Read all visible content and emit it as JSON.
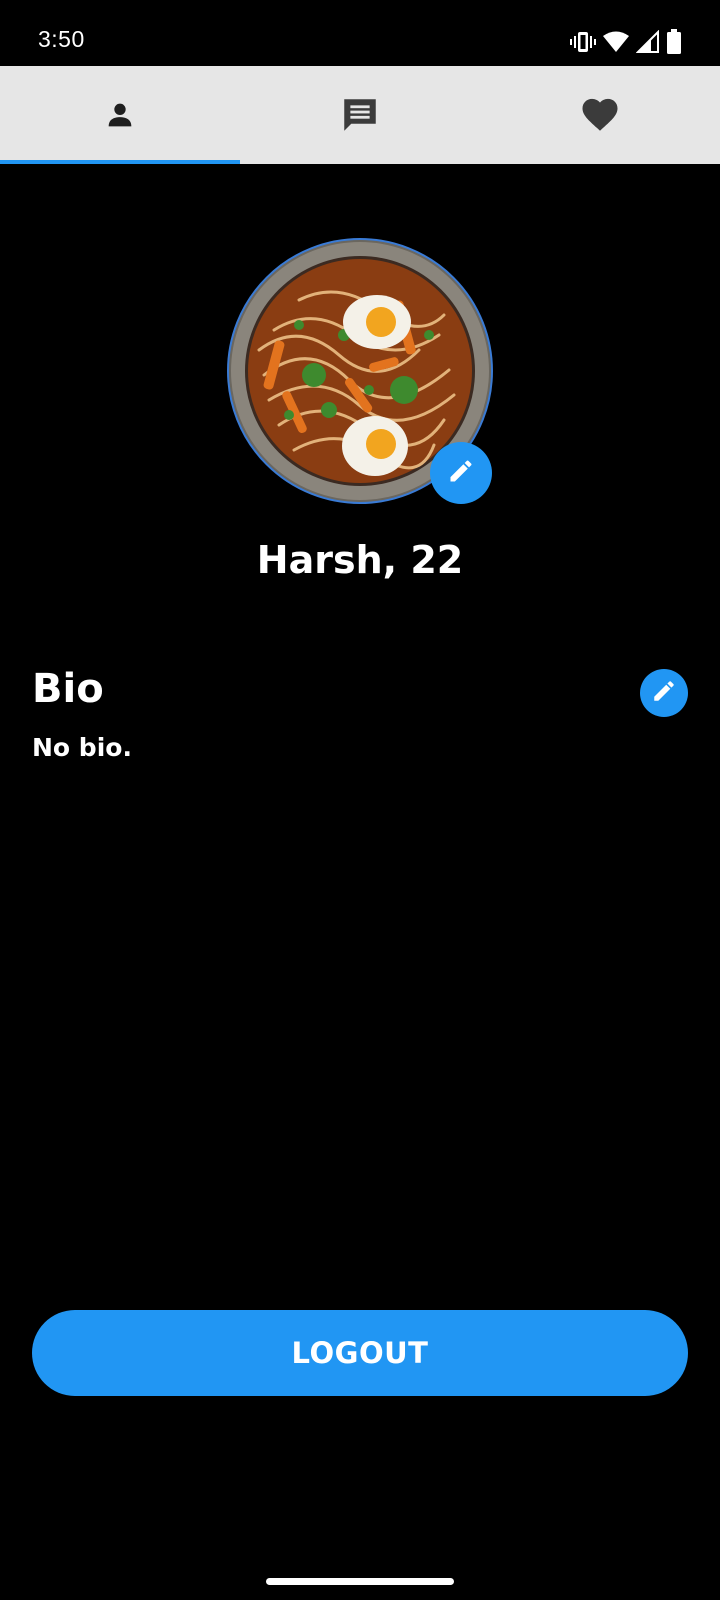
{
  "status_bar": {
    "time": "3:50",
    "icons": [
      "vibrate-icon",
      "wifi-icon",
      "signal-icon",
      "battery-icon"
    ]
  },
  "tabs": [
    {
      "icon": "person-icon",
      "selected": true
    },
    {
      "icon": "chat-icon",
      "selected": false
    },
    {
      "icon": "heart-icon",
      "selected": false
    }
  ],
  "profile": {
    "photo": "noodle-bowl-photo",
    "name": "Harsh, 22"
  },
  "bio": {
    "heading": "Bio",
    "text": "No bio."
  },
  "logout": {
    "label": "LOGOUT"
  },
  "colors": {
    "accent": "#2196f3",
    "background": "#000000",
    "tab_bar": "#e6e6e6",
    "tab_icon": "#3b3b3b",
    "tab_icon_selected": "#1f1f1f"
  }
}
